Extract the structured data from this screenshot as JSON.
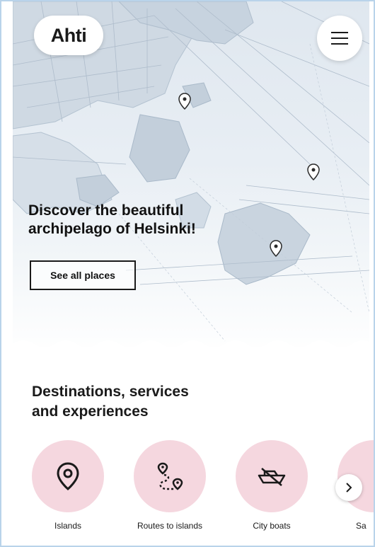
{
  "header": {
    "logo": "Ahti",
    "menu_icon": "hamburger-menu-icon"
  },
  "hero": {
    "title_line1": "Discover the beautiful",
    "title_line2": "archipelago of Helsinki!",
    "cta_label": "See all places"
  },
  "section": {
    "title_line1": "Destinations, services",
    "title_line2": "and experiences"
  },
  "categories": [
    {
      "label": "Islands",
      "icon": "map-pin-icon"
    },
    {
      "label": "Routes to islands",
      "icon": "route-icon"
    },
    {
      "label": "City boats",
      "icon": "boat-icon"
    },
    {
      "label": "Sa",
      "icon": "sauna-icon"
    }
  ],
  "colors": {
    "accent_pink": "#f5d7df",
    "map_bg": "#dfe7ef",
    "text_dark": "#1a1a1a",
    "frame_border": "#b9d3ea"
  }
}
